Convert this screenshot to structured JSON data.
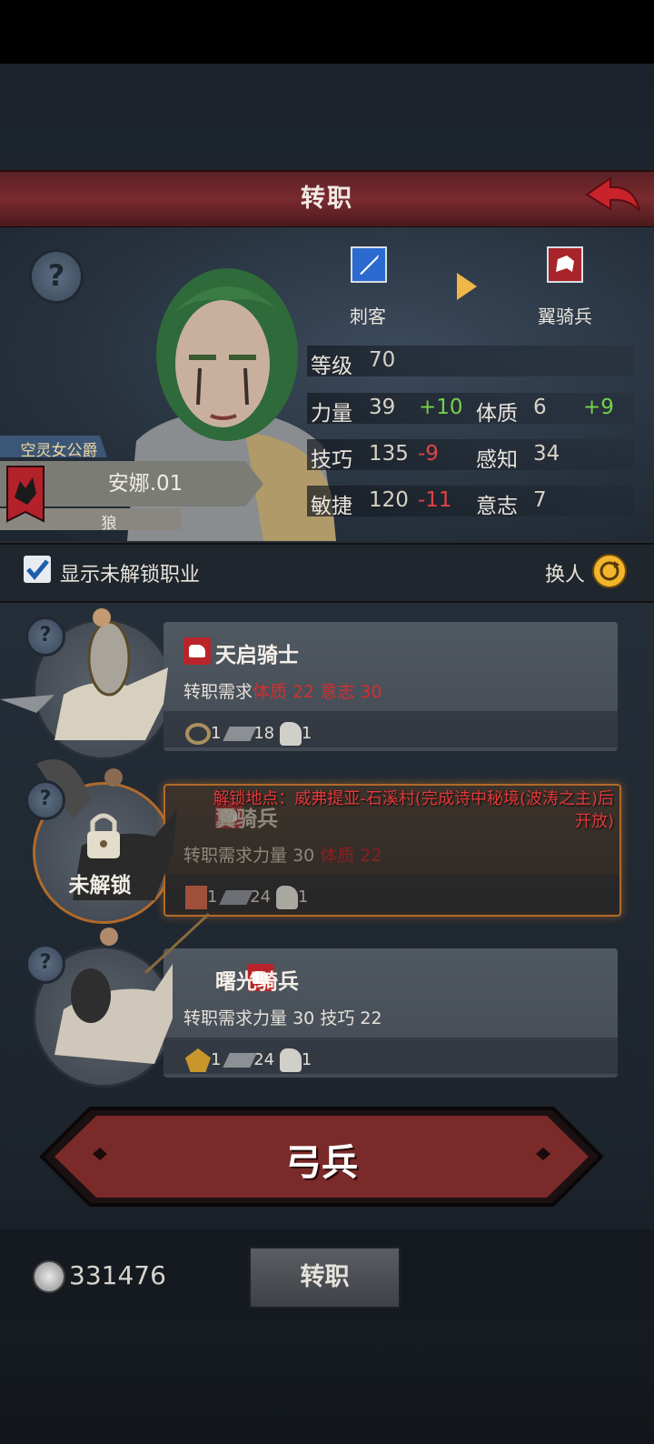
{
  "header": {
    "title": "转职"
  },
  "hero": {
    "from_class": "刺客",
    "to_class": "翼骑兵",
    "title_badge": "空灵女公爵",
    "name": "安娜.01",
    "tag": "狼",
    "stats": {
      "level_label": "等级",
      "level": "70",
      "str_label": "力量",
      "str": "39",
      "str_delta": "+10",
      "con_label": "体质",
      "con": "6",
      "con_delta": "+9",
      "skill_label": "技巧",
      "skill": "135",
      "skill_delta": "-9",
      "per_label": "感知",
      "per": "34",
      "agi_label": "敏捷",
      "agi": "120",
      "agi_delta": "-11",
      "will_label": "意志",
      "will": "7"
    }
  },
  "filter": {
    "show_locked_label": "显示未解锁职业",
    "checked": true,
    "swap_label": "换人"
  },
  "classes": [
    {
      "name": "天启骑士",
      "req_label": "转职需求",
      "req1_name": "体质",
      "req1_val": "22",
      "req2_name": "意志",
      "req2_val": "30",
      "c1": "1",
      "c2": "18",
      "c3": "1"
    },
    {
      "name": "翼骑兵",
      "req_label": "转职需求",
      "req1_name": "力量",
      "req1_val": "30",
      "req2_name": "体质",
      "req2_val": "22",
      "c1": "1",
      "c2": "24",
      "c3": "1",
      "locked_label": "未解锁",
      "unlock_text_1": "解锁地点：威弗提亚-石溪村(完成诗中秘境(波涛之主)后",
      "unlock_text_2": "开放)"
    },
    {
      "name": "曙光骑兵",
      "req_label": "转职需求",
      "req1_name": "力量",
      "req1_val": "30",
      "req2_name": "技巧",
      "req2_val": "22",
      "c1": "1",
      "c2": "24",
      "c3": "1"
    }
  ],
  "main_button": {
    "label": "弓兵"
  },
  "footer": {
    "currency": "331476",
    "convert_label": "转职"
  },
  "colors": {
    "accent_red": "#7a2a2e",
    "bonus_green": "#74d24a",
    "penalty_red": "#e04444"
  }
}
